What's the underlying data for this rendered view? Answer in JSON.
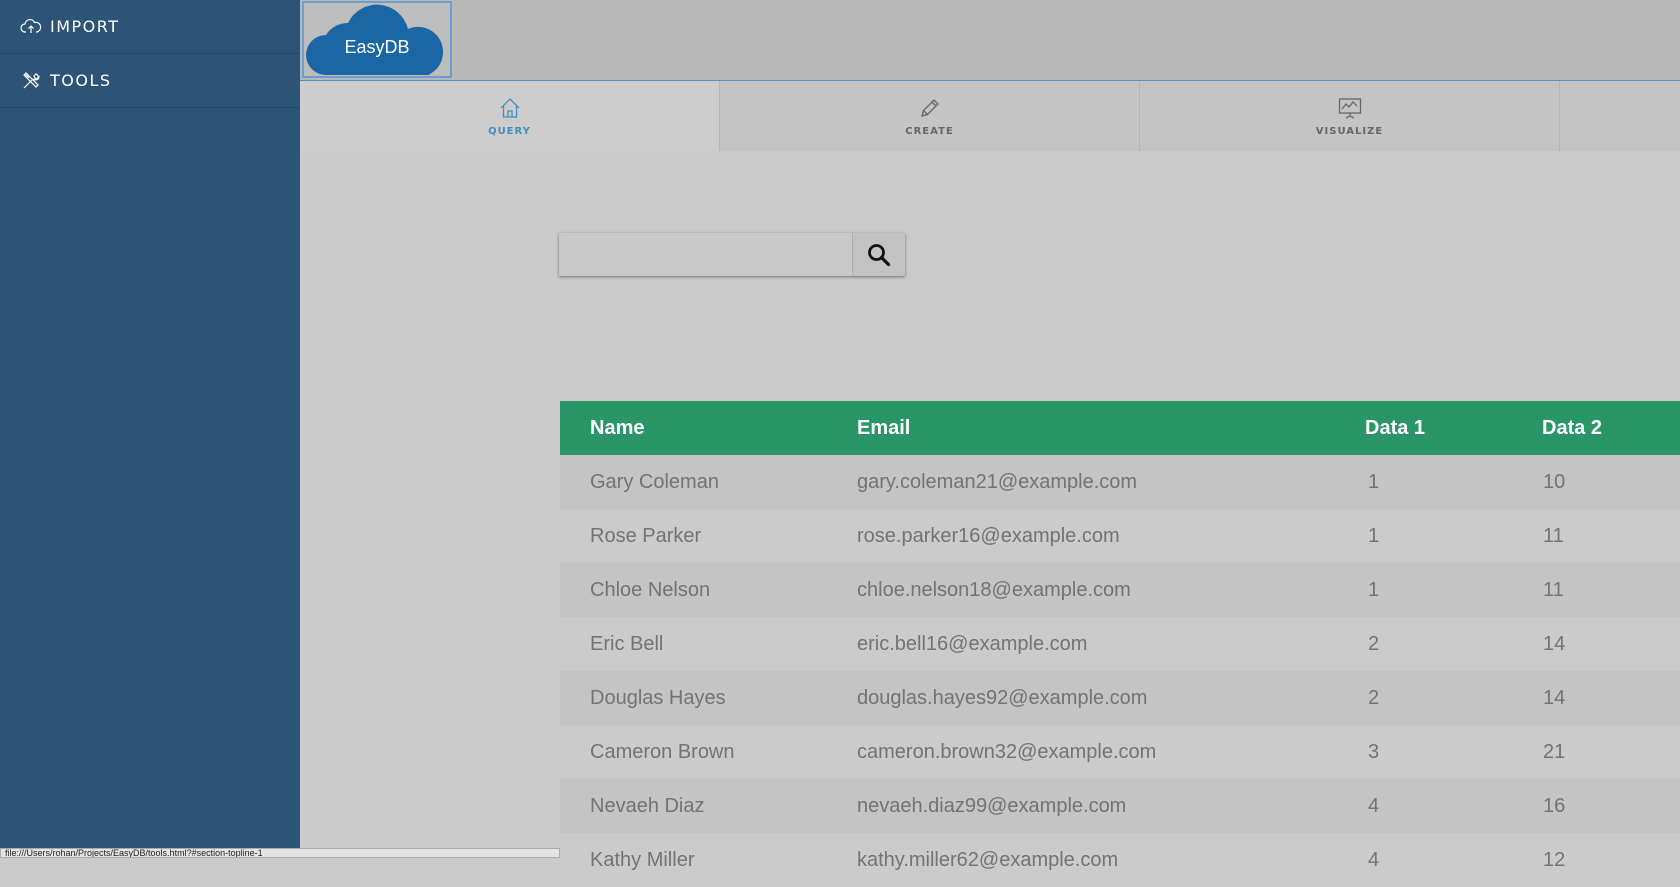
{
  "sidebar": {
    "items": [
      {
        "label": "IMPORT",
        "icon": "cloud-upload-icon"
      },
      {
        "label": "TOOLS",
        "icon": "tools-icon"
      }
    ]
  },
  "logo": {
    "text": "EasyDB"
  },
  "tabs": [
    {
      "label": "QUERY",
      "icon": "home-icon",
      "active": true
    },
    {
      "label": "CREATE",
      "icon": "pencil-icon",
      "active": false
    },
    {
      "label": "VISUALIZE",
      "icon": "presentation-chart-icon",
      "active": false
    }
  ],
  "search": {
    "placeholder": "",
    "value": "",
    "icon": "search-icon"
  },
  "table": {
    "headers": [
      "Name",
      "Email",
      "Data 1",
      "Data 2"
    ],
    "rows": [
      [
        "Gary Coleman",
        "gary.coleman21@example.com",
        "1",
        "10"
      ],
      [
        "Rose Parker",
        "rose.parker16@example.com",
        "1",
        "11"
      ],
      [
        "Chloe Nelson",
        "chloe.nelson18@example.com",
        "1",
        "11"
      ],
      [
        "Eric Bell",
        "eric.bell16@example.com",
        "2",
        "14"
      ],
      [
        "Douglas Hayes",
        "douglas.hayes92@example.com",
        "2",
        "14"
      ],
      [
        "Cameron Brown",
        "cameron.brown32@example.com",
        "3",
        "21"
      ],
      [
        "Nevaeh Diaz",
        "nevaeh.diaz99@example.com",
        "4",
        "16"
      ],
      [
        "Kathy Miller",
        "kathy.miller62@example.com",
        "4",
        "12"
      ]
    ]
  },
  "status": {
    "url": "file:///Users/rohan/Projects/EasyDB/tools.html?#section-topline-1"
  },
  "colors": {
    "sidebar": "#2d5476",
    "header_row": "#2a9668",
    "active_tab": "#3f8fc0",
    "logo_cloud": "#1b67a6"
  }
}
